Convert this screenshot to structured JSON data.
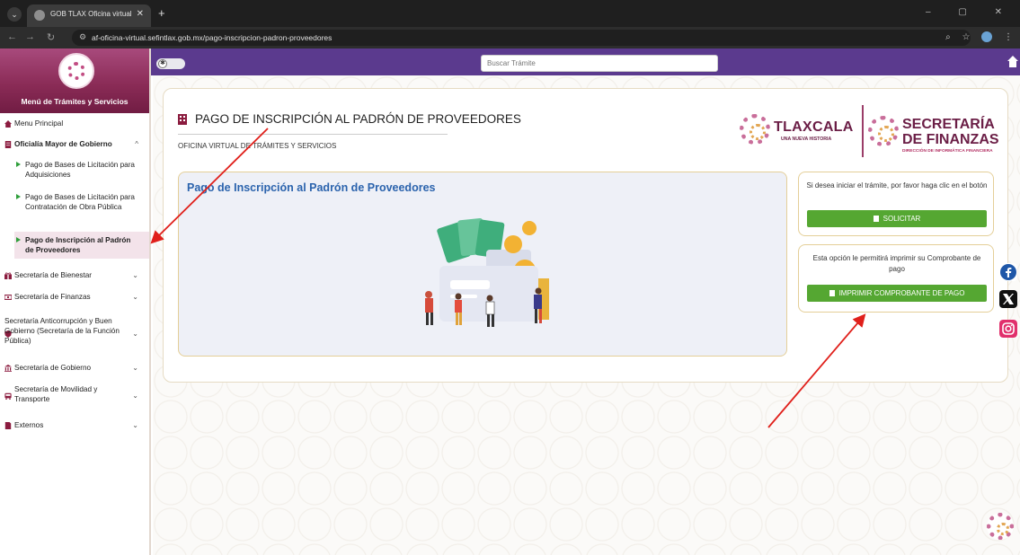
{
  "browser": {
    "tab_title": "GOB TLAX Oficina virtual de Trá",
    "tab_close": "✕",
    "new_tab": "+",
    "url": "af-oficina-virtual.sefintlax.gob.mx/pago-inscripcion-padron-proveedores"
  },
  "sidebar": {
    "title": "Menú de Trámites y Servicios",
    "items": [
      {
        "label": "Menu Principal"
      },
      {
        "label": "Oficialía Mayor de Gobierno"
      },
      {
        "label": "Secretaría de Bienestar"
      },
      {
        "label": "Secretaría de Finanzas"
      },
      {
        "label": "Secretaría Anticorrupción y Buen Gobierno (Secretaría de la Función Pública)"
      },
      {
        "label": "Secretaría de Gobierno"
      },
      {
        "label": "Secretaría de Movilidad y Transporte"
      },
      {
        "label": "Externos"
      }
    ],
    "subitems": [
      {
        "label": "Pago de Bases de Licitación para Adquisiciones"
      },
      {
        "label": "Pago de Bases de Licitación para Contratación de Obra Pública"
      },
      {
        "label": "Pago de Inscripción al Padrón de Proveedores"
      }
    ]
  },
  "topbar": {
    "search_placeholder": "Buscar Trámite"
  },
  "page": {
    "title": "PAGO DE INSCRIPCIÓN AL PADRÓN DE PROVEEDORES",
    "subtitle": "OFICINA VIRTUAL DE TRÁMITES Y SERVICIOS",
    "panel_title": "Pago de Inscripción al Padrón de Proveedores"
  },
  "logos": {
    "tlaxcala_name": "TLAXCALA",
    "tlaxcala_tag": "UNA NUEVA HISTORIA",
    "finanzas_line1": "SECRETARÍA",
    "finanzas_line2": "DE FINANZAS",
    "finanzas_tag": "DIRECCIÓN DE INFORMÁTICA FINANCIERA"
  },
  "actions": {
    "solicitar_text": "Si desea iniciar el trámite, por favor haga clic en el botón",
    "solicitar_label": "SOLICITAR",
    "imprimir_text": "Esta opción le permitirá imprimir su Comprobante de pago",
    "imprimir_label": "IMPRIMIR COMPROBANTE DE PAGO"
  },
  "colors": {
    "sidebar_header": "#8b2c57",
    "topbar": "#5b3a8e",
    "button_green": "#55a732",
    "panel_title_blue": "#2b63ad",
    "annotation_arrow": "#e0201b"
  }
}
